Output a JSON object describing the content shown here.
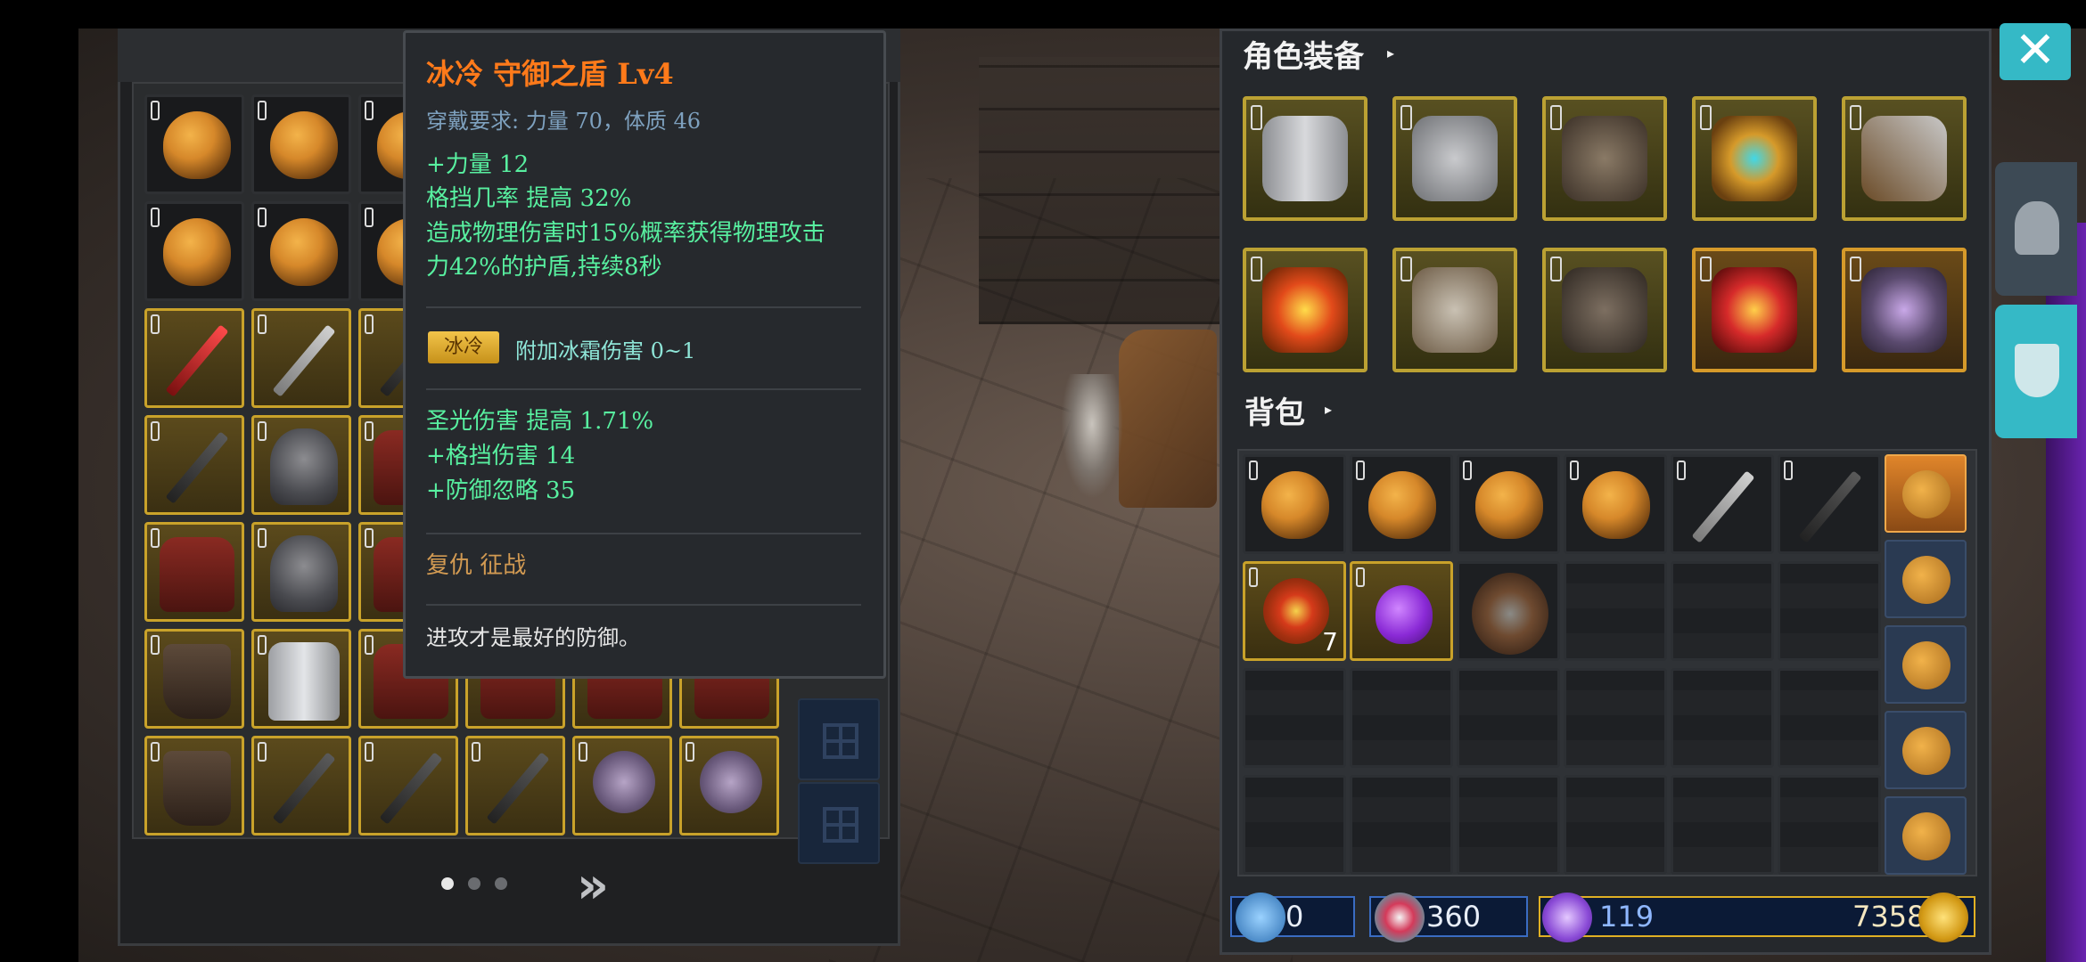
{
  "tooltip": {
    "title": "冰冷 守御之盾 Lv4",
    "requirement": "穿戴要求:   力量 70，体质 46",
    "base_stats": [
      "+力量 12",
      "格挡几率 提高 32%",
      "造成物理伤害时15%概率获得物理攻击",
      "力42%的护盾,持续8秒"
    ],
    "element_badge": "冰冷",
    "element_effect": "附加冰霜伤害 0~1",
    "extra_stats": [
      "圣光伤害 提高 1.71%",
      "+格挡伤害 14",
      "+防御忽略 35"
    ],
    "set_names": "复仇   征战",
    "flavor": "进攻才是最好的防御。"
  },
  "equipment": {
    "title": "角色装备",
    "caret": "▸",
    "slots": [
      {
        "icon": "chest-armor-icon"
      },
      {
        "icon": "silver-armor-icon"
      },
      {
        "icon": "dark-armor-icon"
      },
      {
        "icon": "ring-icon"
      },
      {
        "icon": "axe-icon"
      },
      {
        "icon": "amulet-icon"
      },
      {
        "icon": "gloves-icon"
      },
      {
        "icon": "boots-icon"
      },
      {
        "icon": "red-ring-icon"
      },
      {
        "icon": "shield-icon"
      }
    ]
  },
  "backpack": {
    "title": "背包",
    "caret": "▸",
    "scroll_count": "7",
    "tabs": [
      "backpack-tab-icon",
      "bag-tab-icon",
      "pouch-tab-icon",
      "bag-tab-icon",
      "sack-tab-icon"
    ]
  },
  "storage": {
    "next_label": "»",
    "page_count": 3,
    "active_page": 1
  },
  "currency": {
    "magic": "0",
    "reputation": "360",
    "crystal": "119",
    "gold": "7358"
  },
  "buttons": {
    "close": "✕"
  }
}
